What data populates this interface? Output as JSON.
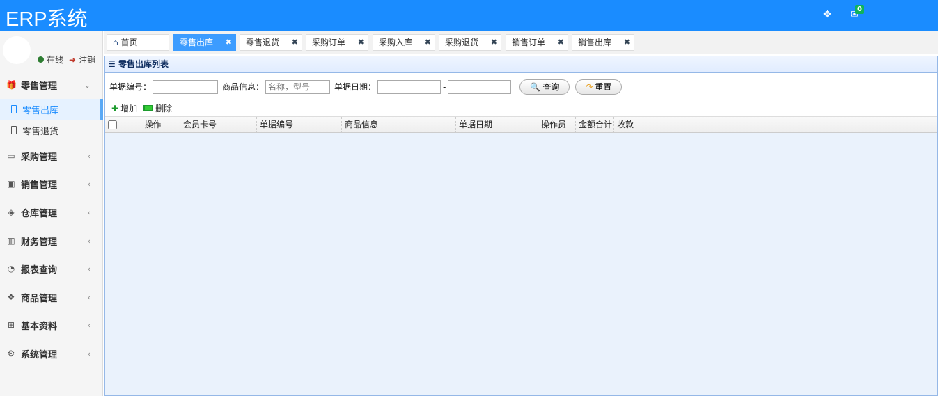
{
  "app": {
    "title": "ERP系统",
    "mail_count": "0"
  },
  "user": {
    "online": "在线",
    "logout": "注销"
  },
  "sidebar": {
    "group_open": {
      "label": "零售管理",
      "items": [
        "零售出库",
        "零售退货"
      ]
    },
    "groups": [
      "采购管理",
      "销售管理",
      "仓库管理",
      "财务管理",
      "报表查询",
      "商品管理",
      "基本资料",
      "系统管理"
    ]
  },
  "tabs": [
    "首页",
    "零售出库",
    "零售退货",
    "采购订单",
    "采购入库",
    "采购退货",
    "销售订单",
    "销售出库"
  ],
  "panel": {
    "title": "零售出库列表"
  },
  "search": {
    "bill_no_label": "单据编号：",
    "bill_no_value": "",
    "goods_label": "商品信息：",
    "goods_placeholder": "名称，型号",
    "date_label": "单据日期：",
    "date_from": "",
    "date_sep": "-",
    "date_to": "",
    "query": "查询",
    "reset": "重置"
  },
  "toolbar": {
    "add": "增加",
    "delete": "删除"
  },
  "table": {
    "columns": [
      "操作",
      "会员卡号",
      "单据编号",
      "商品信息",
      "单据日期",
      "操作员",
      "金额合计",
      "收款"
    ],
    "rows": []
  }
}
